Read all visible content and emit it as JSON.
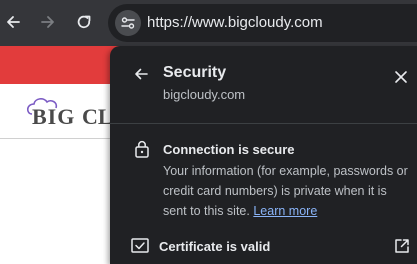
{
  "browser": {
    "url": "https://www.bigcloudy.com"
  },
  "page": {
    "logo_text": "BigClou"
  },
  "security_popup": {
    "title": "Security",
    "domain": "bigcloudy.com",
    "connection_title": "Connection is secure",
    "connection_description": "Your information (for example, passwords or credit card numbers) is private when it is sent to this site.",
    "learn_more_label": "Learn more",
    "certificate_label": "Certificate is valid"
  },
  "colors": {
    "toolbar": "#35363a",
    "popup_background": "#202124",
    "link": "#8ab4f8",
    "page_accent": "#e23c3c"
  }
}
